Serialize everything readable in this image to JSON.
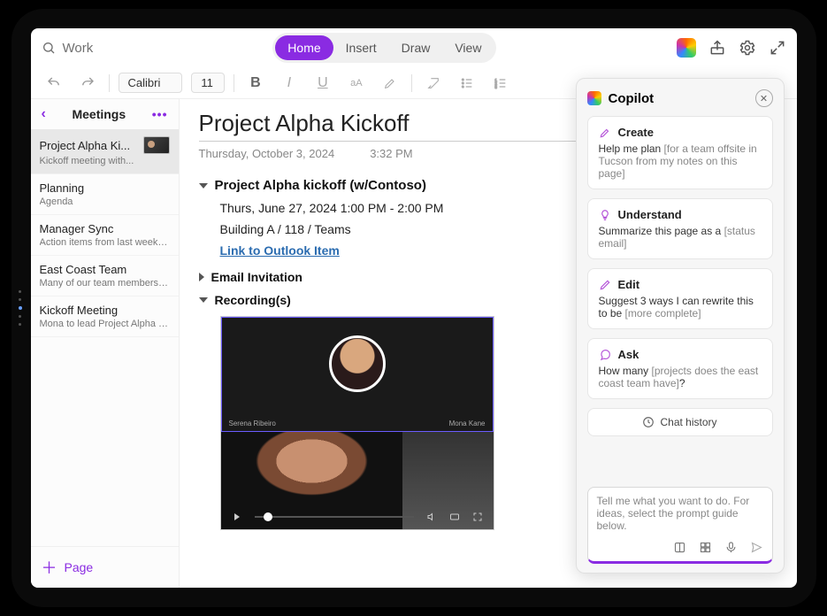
{
  "search": {
    "placeholder": "Work"
  },
  "tabs": [
    "Home",
    "Insert",
    "Draw",
    "View"
  ],
  "active_tab": 0,
  "ribbon": {
    "font": "Calibri",
    "size": "11"
  },
  "sidebar": {
    "title": "Meetings",
    "new_page": "Page",
    "items": [
      {
        "title": "Project Alpha Ki...",
        "sub": "Kickoff meeting with...",
        "thumb": true
      },
      {
        "title": "Planning",
        "sub": "Agenda"
      },
      {
        "title": "Manager Sync",
        "sub": "Action items from last weeks..."
      },
      {
        "title": "East Coast Team",
        "sub": "Many of our team members ar..."
      },
      {
        "title": "Kickoff Meeting",
        "sub": "Mona to lead Project Alpha ki..."
      }
    ]
  },
  "note": {
    "title": "Project Alpha Kickoff",
    "date": "Thursday, October 3, 2024",
    "time": "3:32 PM",
    "meeting_title": "Project Alpha kickoff (w/Contoso)",
    "meeting_when": "Thurs, June 27, 2024 1:00 PM - 2:00 PM",
    "meeting_where": "Building A / 118 / Teams",
    "outlook_link": "Link to Outlook Item",
    "email_invite": "Email Invitation",
    "recordings": "Recording(s)",
    "vid_name_left": "Serena Ribeiro",
    "vid_name_right": "Mona Kane"
  },
  "copilot": {
    "title": "Copilot",
    "cards": [
      {
        "icon": "create",
        "title": "Create",
        "text": "Help me plan ",
        "gray": "[for a team offsite in Tucson from my notes on this page]"
      },
      {
        "icon": "understand",
        "title": "Understand",
        "text": "Summarize this page as a ",
        "gray": "[status email]"
      },
      {
        "icon": "edit",
        "title": "Edit",
        "text": "Suggest 3 ways I can rewrite this to be ",
        "gray": "[more complete]"
      },
      {
        "icon": "ask",
        "title": "Ask",
        "text": "How many ",
        "gray": "[projects does the east coast team have]",
        "tail": "?"
      }
    ],
    "chat_history": "Chat history",
    "prompt_placeholder": "Tell me what you want to do. For ideas, select the prompt guide below."
  }
}
